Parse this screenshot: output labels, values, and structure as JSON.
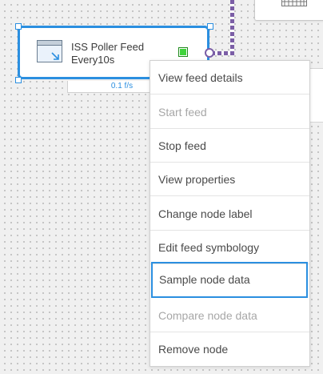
{
  "node": {
    "title_line1": "ISS Poller Feed",
    "title_line2": "Every10s",
    "rate": "0.1 f/s",
    "status_color": "#3fd33b"
  },
  "connector": {
    "color": "#7b5ea6"
  },
  "accent_color": "#2b8fe0",
  "context_menu": {
    "items": [
      {
        "label": "View feed details",
        "enabled": true
      },
      {
        "label": "Start feed",
        "enabled": false
      },
      {
        "label": "Stop feed",
        "enabled": true
      },
      {
        "label": "View properties",
        "enabled": true
      },
      {
        "label": "Change node label",
        "enabled": true
      },
      {
        "label": "Edit feed symbology",
        "enabled": true
      },
      {
        "label": "Sample node data",
        "enabled": true,
        "highlighted": true
      },
      {
        "label": "Compare node data",
        "enabled": false
      },
      {
        "label": "Remove node",
        "enabled": true
      }
    ]
  },
  "icons": {
    "feed_node_icon": "window-arrow-icon",
    "partial_node_icon": "keyboard-icon"
  }
}
